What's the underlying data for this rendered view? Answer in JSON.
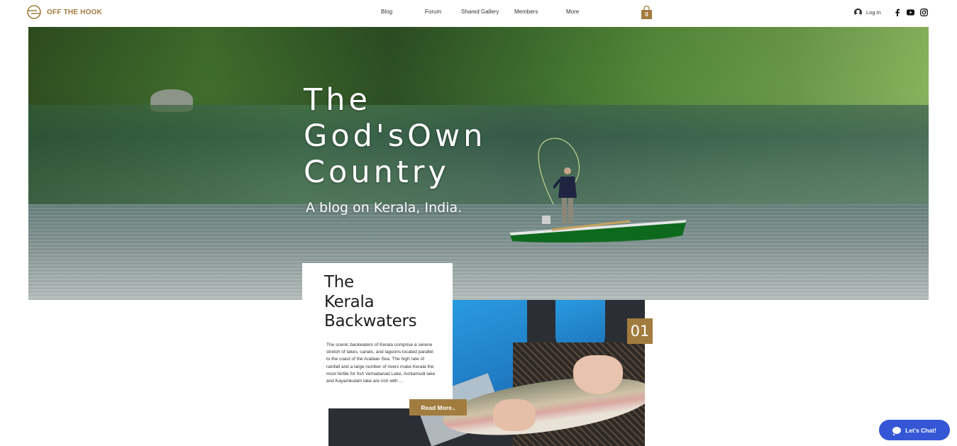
{
  "header": {
    "brand": "OFF THE HOOK",
    "nav": [
      {
        "label": "Blog"
      },
      {
        "label": "Forum"
      },
      {
        "label": "Shared Gallery"
      },
      {
        "label": "Members"
      },
      {
        "label": "More"
      }
    ],
    "cart_count": "0",
    "login_label": "Log In",
    "social_icons": [
      "facebook-icon",
      "youtube-icon",
      "instagram-icon"
    ]
  },
  "hero": {
    "title_lines": [
      "The",
      "God'sOwn",
      "Country"
    ],
    "subtitle": "A blog on Kerala, India."
  },
  "post": {
    "title_lines": [
      "The",
      "Kerala",
      "Backwaters"
    ],
    "excerpt": "The scenic backwaters of Kerala comprise a serene stretch of lakes, canals, and lagoons located parallel to the coast of the Arabian Sea. The high rate of rainfall and a large number of rivers make Kerala the most fertile for fish Vemabanad Lake, Ashtamudi lake and Kayamkulam lake are rich with ...",
    "read_more": "Read More..",
    "number": "01"
  },
  "chat": {
    "label": "Let's Chat!"
  },
  "colors": {
    "brand_gold": "#a27c3f",
    "chat_blue": "#3557d6"
  }
}
